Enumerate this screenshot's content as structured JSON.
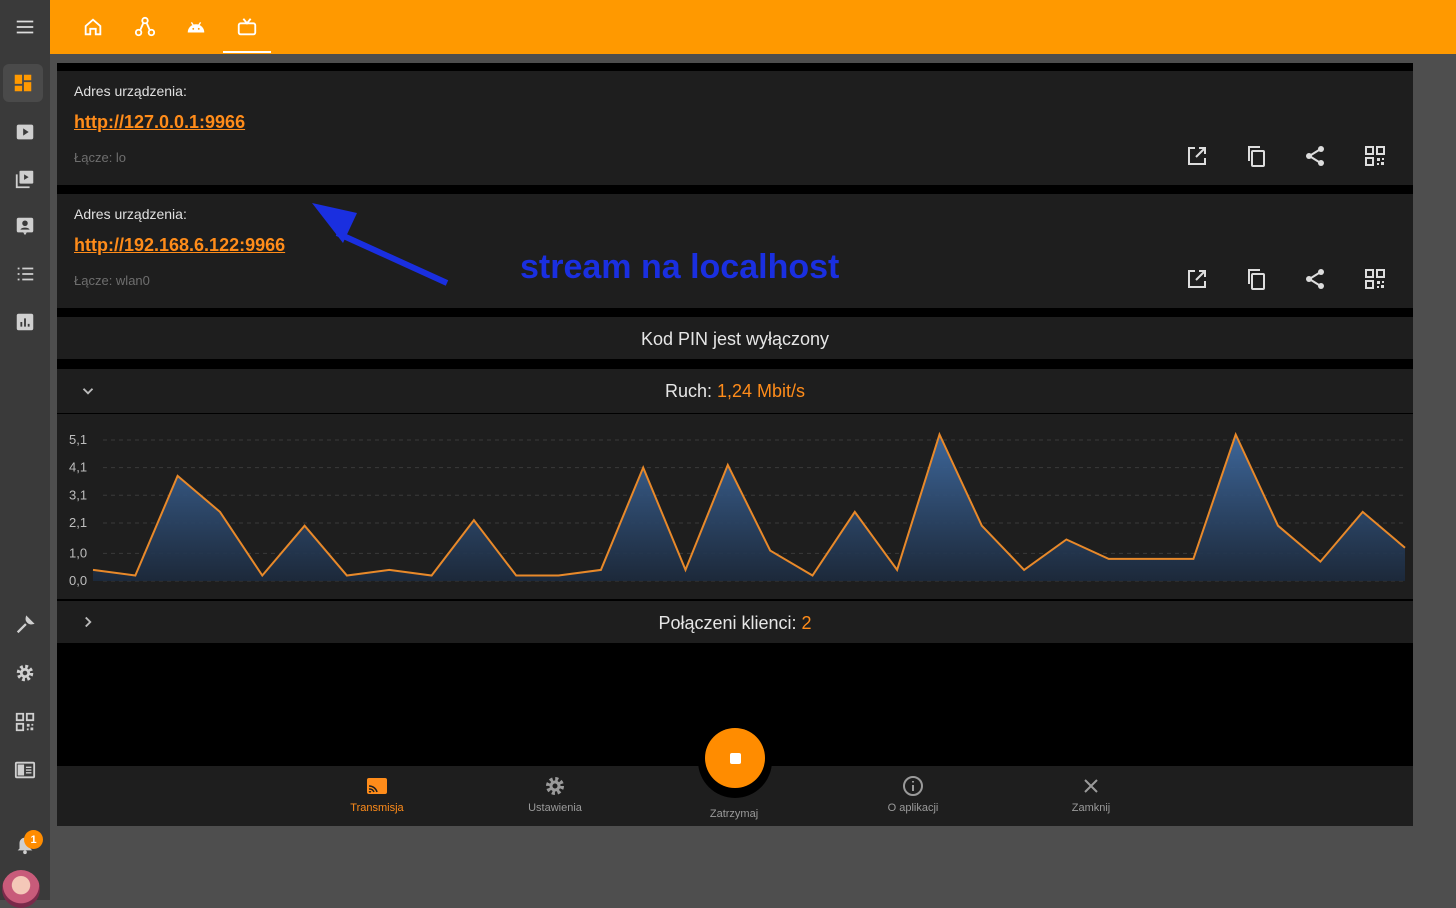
{
  "addresses": [
    {
      "label": "Adres urządzenia:",
      "url": "http://127.0.0.1:9966",
      "iface": "Łącze: lo"
    },
    {
      "label": "Adres urządzenia:",
      "url": "http://192.168.6.122:9966",
      "iface": "Łącze: wlan0"
    }
  ],
  "pin_status": "Kod PIN jest wyłączony",
  "traffic": {
    "label": "Ruch:",
    "value": "1,24 Mbit/s"
  },
  "clients": {
    "label": "Połączeni klienci:",
    "value": "2"
  },
  "annotation": "stream na localhost",
  "notification_count": "1",
  "bottom_nav": {
    "stream": "Transmisja",
    "settings": "Ustawienia",
    "stop": "Zatrzymaj",
    "about": "O aplikacji",
    "close": "Zamknij"
  },
  "colors": {
    "accent": "#ff9900",
    "card": "#1e1e1e",
    "annotation": "#1a2fe0"
  },
  "chart_data": {
    "type": "area",
    "y_ticks": [
      "5,1",
      "4,1",
      "3,1",
      "2,1",
      "1,0",
      "0,0"
    ],
    "ylim": [
      0,
      5.3
    ],
    "grid": true,
    "values": [
      0.4,
      0.2,
      3.8,
      2.5,
      0.2,
      2.0,
      0.2,
      0.4,
      0.2,
      2.2,
      0.2,
      0.2,
      0.4,
      4.1,
      0.4,
      4.2,
      1.1,
      0.2,
      2.5,
      0.4,
      5.5,
      2.0,
      0.4,
      1.5,
      0.8,
      0.8,
      0.8,
      5.6,
      2.0,
      0.7,
      2.5,
      1.2
    ]
  }
}
